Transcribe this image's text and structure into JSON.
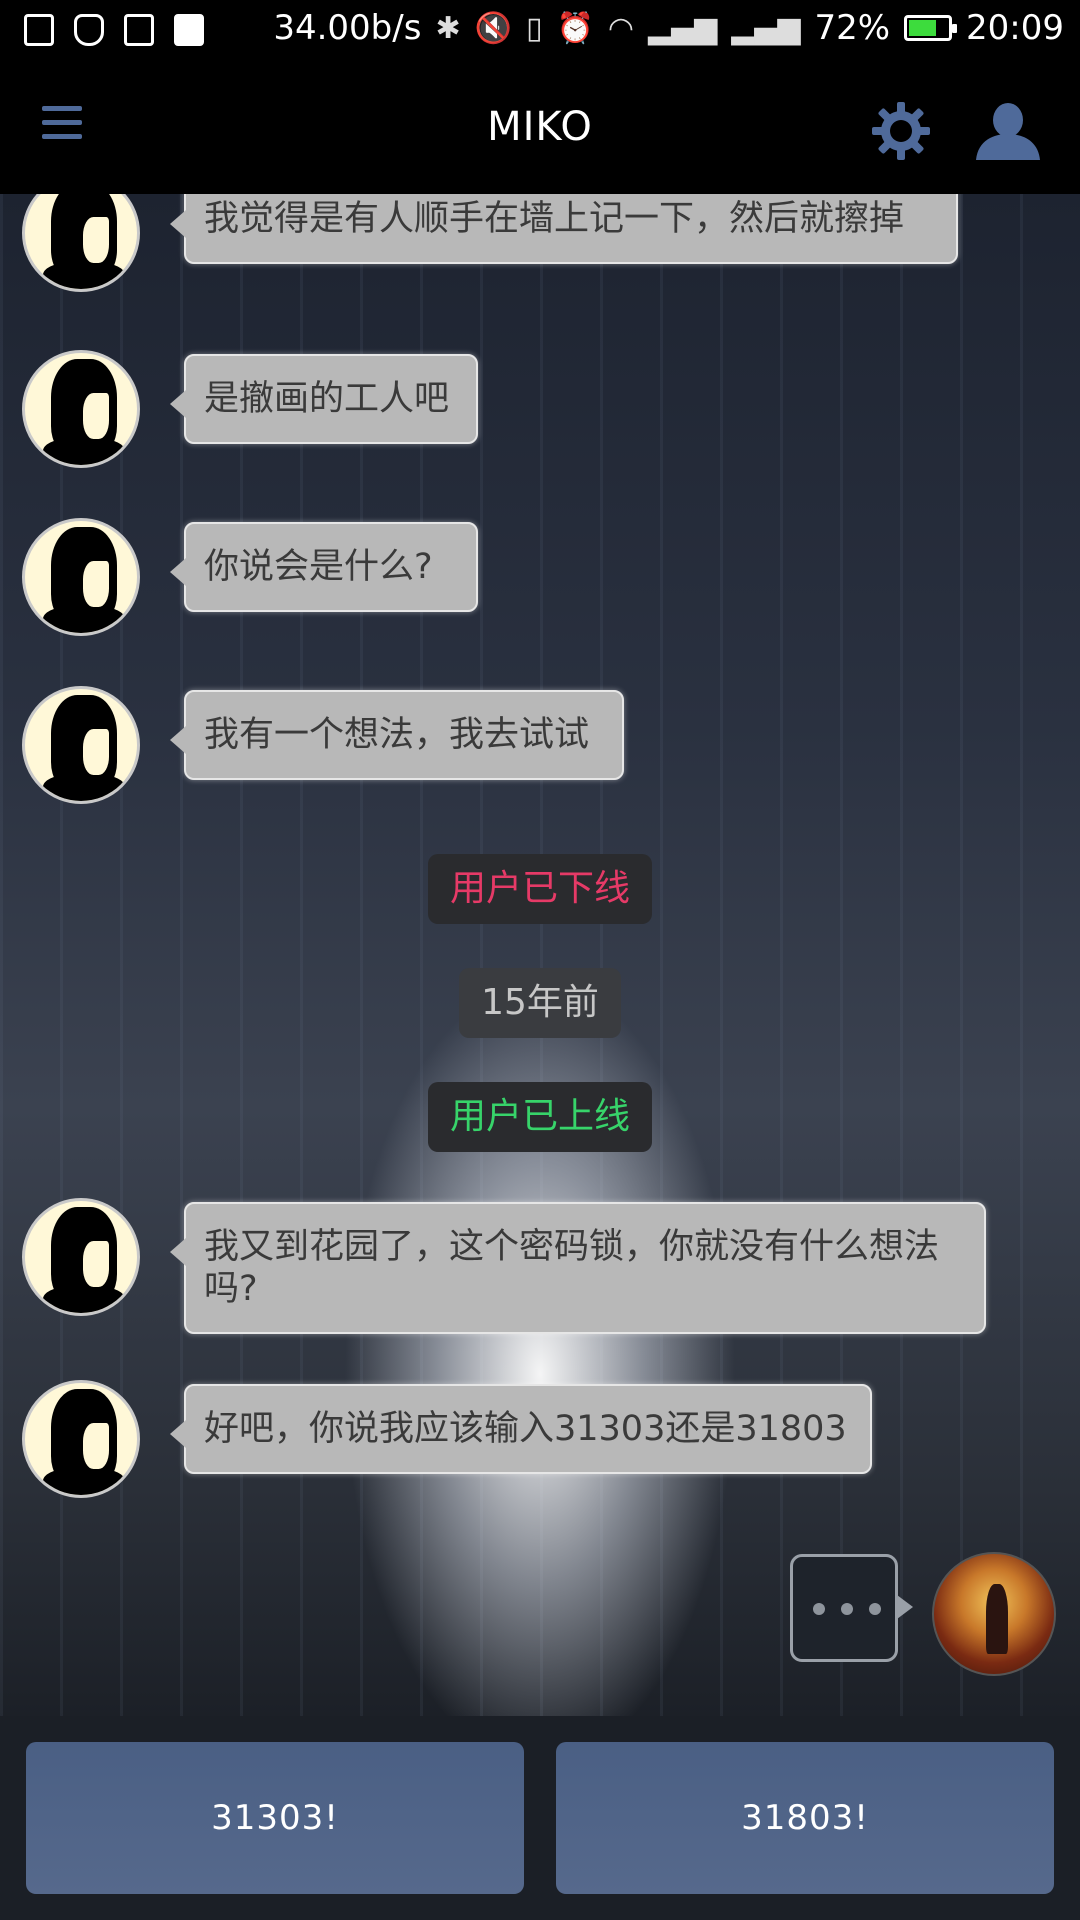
{
  "status_bar": {
    "speed": "34.00b/s",
    "battery": "72%",
    "battery_level": 0.72,
    "time": "20:09"
  },
  "header": {
    "title": "MIKO",
    "icons": [
      "menu-icon",
      "gear-icon",
      "user-icon"
    ]
  },
  "messages": [
    {
      "text": "我觉得是有人顺手在墙上记一下，然后就擦掉"
    },
    {
      "text": "是撤画的工人吧"
    },
    {
      "text": "你说会是什么?"
    },
    {
      "text": "我有一个想法，我去试试"
    },
    {
      "text": "我又到花园了，这个密码锁，你就没有什么想法吗?"
    },
    {
      "text": "好吧，你说我应该输入31303还是31803"
    }
  ],
  "system": {
    "offline": "用户已下线",
    "time_gap": "15年前",
    "online": "用户已上线"
  },
  "replies": [
    "31303!",
    "31803!"
  ],
  "colors": {
    "offline": "#e63a67",
    "online": "#37d46a",
    "accent": "#4f6a9a",
    "bubble": "#b8b8b8"
  }
}
